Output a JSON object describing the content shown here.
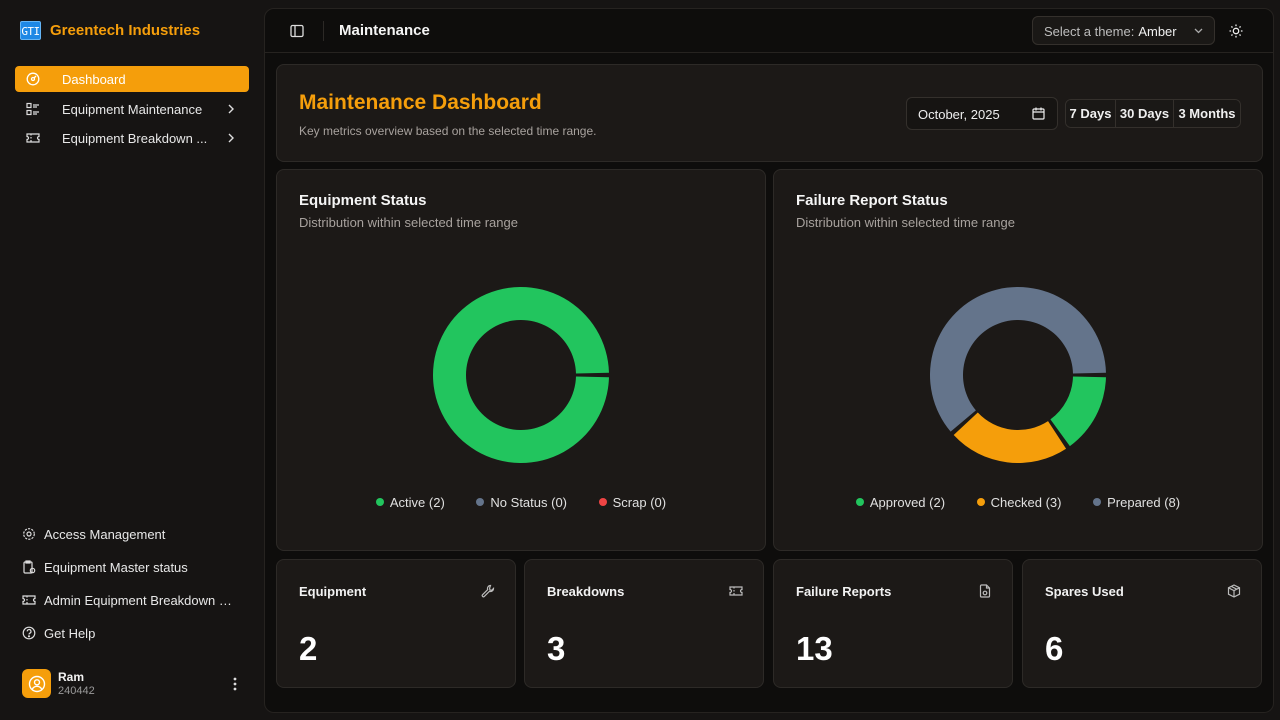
{
  "brand": {
    "logo_text": "GTI",
    "name": "Greentech Industries"
  },
  "sidebar": {
    "items": [
      {
        "label": "Dashboard",
        "icon": "gauge-icon",
        "active": true
      },
      {
        "label": "Equipment Maintenance",
        "icon": "list-icon",
        "has_children": true
      },
      {
        "label": "Equipment Breakdown ...",
        "icon": "ticket-icon",
        "has_children": true
      }
    ],
    "bottom_items": [
      {
        "label": "Access Management",
        "icon": "gear-icon"
      },
      {
        "label": "Equipment Master status",
        "icon": "clipboard-icon"
      },
      {
        "label": "Admin Equipment Breakdown a...",
        "icon": "ticket-icon"
      },
      {
        "label": "Get Help",
        "icon": "help-icon"
      }
    ],
    "user": {
      "name": "Ram",
      "id": "240442"
    }
  },
  "topbar": {
    "title": "Maintenance",
    "theme_label": "Select a theme:",
    "theme_value": "Amber"
  },
  "hero": {
    "title": "Maintenance Dashboard",
    "subtitle": "Key metrics overview based on the selected time range.",
    "date_value": "October, 2025",
    "ranges": [
      "7 Days",
      "30 Days",
      "3 Months"
    ]
  },
  "charts": {
    "equipment": {
      "title": "Equipment Status",
      "subtitle": "Distribution within selected time range"
    },
    "failure": {
      "title": "Failure Report Status",
      "subtitle": "Distribution within selected time range"
    }
  },
  "chart_data": [
    {
      "type": "pie",
      "title": "Equipment Status",
      "categories": [
        "Active",
        "No Status",
        "Scrap"
      ],
      "values": [
        2,
        0,
        0
      ],
      "legend_labels": [
        "Active (2)",
        "No Status (0)",
        "Scrap (0)"
      ],
      "colors": [
        "#22c55e",
        "#64748b",
        "#ef4444"
      ],
      "legend": "bottom"
    },
    {
      "type": "pie",
      "title": "Failure Report Status",
      "categories": [
        "Approved",
        "Checked",
        "Prepared"
      ],
      "values": [
        2,
        3,
        8
      ],
      "legend_labels": [
        "Approved (2)",
        "Checked (3)",
        "Prepared (8)"
      ],
      "colors": [
        "#22c55e",
        "#f59e0b",
        "#64748b"
      ],
      "legend": "bottom"
    }
  ],
  "stats": [
    {
      "label": "Equipment",
      "value": "2",
      "icon": "wrench-icon"
    },
    {
      "label": "Breakdowns",
      "value": "3",
      "icon": "ticket-icon"
    },
    {
      "label": "Failure Reports",
      "value": "13",
      "icon": "file-report-icon"
    },
    {
      "label": "Spares Used",
      "value": "6",
      "icon": "package-icon"
    }
  ],
  "colors": {
    "accent": "#f59e0b",
    "background": "#161413",
    "card": "#1c1917"
  }
}
